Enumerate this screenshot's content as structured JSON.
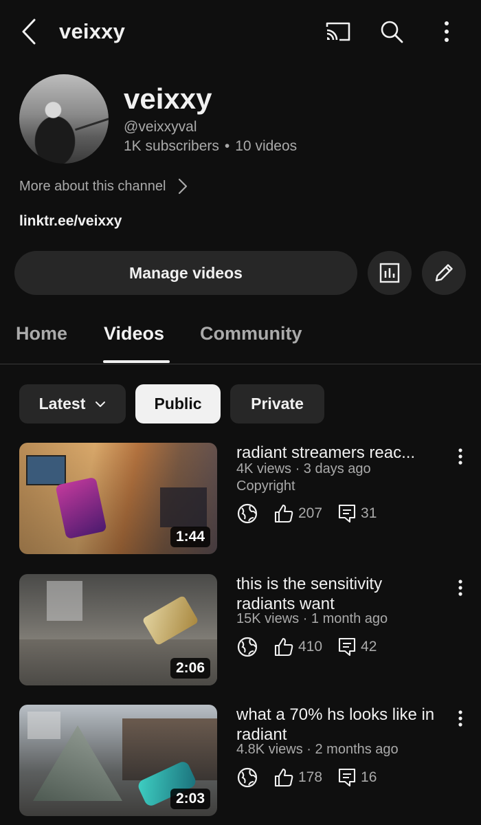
{
  "header": {
    "title": "veixxy",
    "icons": {
      "back": "back-arrow-icon",
      "cast": "cast-icon",
      "search": "search-icon",
      "more": "more-vertical-icon"
    }
  },
  "channel": {
    "name": "veixxy",
    "handle": "@veixxyval",
    "subscribers": "1K subscribers",
    "videos_count": "10 videos",
    "separator": "•",
    "more_about": "More about this channel",
    "link": "linktr.ee/veixxy"
  },
  "actions": {
    "manage_videos": "Manage videos",
    "analytics_icon": "analytics-icon",
    "edit_icon": "pencil-icon"
  },
  "tabs": [
    {
      "label": "Home",
      "active": false
    },
    {
      "label": "Videos",
      "active": true
    },
    {
      "label": "Community",
      "active": false
    }
  ],
  "chips": {
    "latest": "Latest",
    "public": "Public",
    "private": "Private"
  },
  "videos": [
    {
      "title": "radiant streamers reac...",
      "meta": "4K views · 3 days ago",
      "extra": "Copyright",
      "duration": "1:44",
      "likes": "207",
      "comments": "31"
    },
    {
      "title": "this is the sensitivity radiants want",
      "meta": "15K views · 1 month ago",
      "extra": "",
      "duration": "2:06",
      "likes": "410",
      "comments": "42"
    },
    {
      "title": "what a 70% hs looks like in radiant",
      "meta": "4.8K views · 2 months ago",
      "extra": "",
      "duration": "2:03",
      "likes": "178",
      "comments": "16"
    }
  ],
  "colors": {
    "background": "#0f0f0f",
    "surface": "#272727",
    "text_primary": "#f1f1f1",
    "text_secondary": "#aaaaaa",
    "chip_selected_bg": "#f1f1f1"
  }
}
